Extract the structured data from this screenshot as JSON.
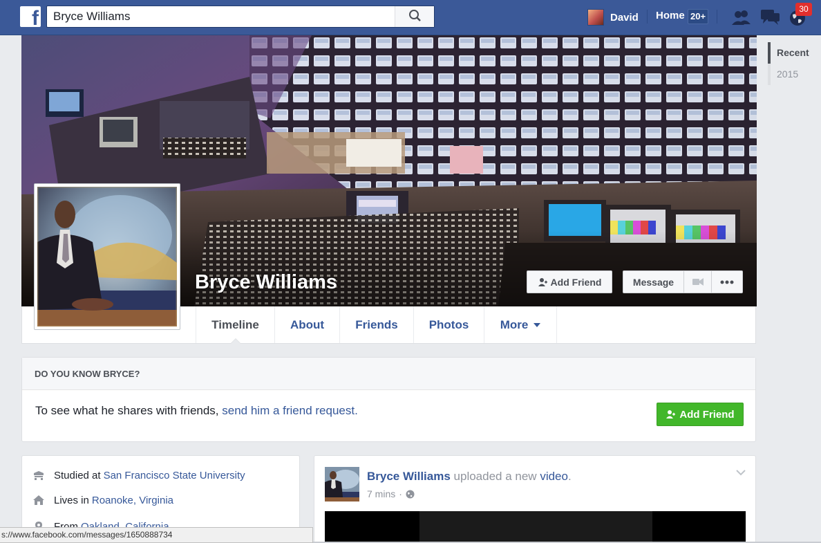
{
  "topbar": {
    "logo_letter": "f",
    "search_value": "Bryce Williams",
    "user_name": "David",
    "home_label": "Home",
    "home_count": "20+",
    "notification_count": "30"
  },
  "year_nav": [
    "Recent",
    "2015"
  ],
  "profile": {
    "name": "Bryce Williams",
    "add_friend": "Add Friend",
    "message": "Message"
  },
  "tabs": [
    "Timeline",
    "About",
    "Friends",
    "Photos",
    "More"
  ],
  "know": {
    "heading": "DO YOU KNOW BRYCE?",
    "text": "To see what he shares with friends,",
    "link": "send him a friend request.",
    "button": "Add Friend"
  },
  "intro": {
    "studied_prefix": "Studied at",
    "studied_link": "San Francisco State University",
    "lives_prefix": "Lives in",
    "lives_link": "Roanoke, Virginia",
    "from_prefix": "From",
    "from_link": "Oakland, California"
  },
  "post": {
    "author": "Bryce Williams",
    "action": "uploaded a new",
    "object": "video",
    "period": ".",
    "time": "7 mins",
    "dot": "·"
  },
  "status_url": "s://www.facebook.com/messages/1650888734",
  "colors": {
    "brand_blue": "#3b5998",
    "link_blue": "#365899",
    "green": "#42b72a",
    "badge_red": "#e22f2d"
  }
}
